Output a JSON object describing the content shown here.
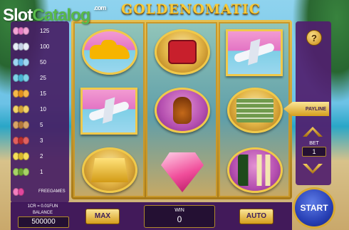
{
  "branding": {
    "site_logo_part1": "Slot",
    "site_logo_part2": "Catalog",
    "site_logo_suffix": ".com",
    "game_title": "GOLDENOMATIC"
  },
  "paytable": {
    "rows": [
      {
        "icon": "pink-triple-icon",
        "value": "125",
        "colors": [
          "#f2a5d6",
          "#e77ac3",
          "#f2a5d6"
        ]
      },
      {
        "icon": "white-triple-icon",
        "value": "100",
        "colors": [
          "#e8eef8",
          "#c5d1e6",
          "#e8eef8"
        ]
      },
      {
        "icon": "blue-triple-icon",
        "value": "50",
        "colors": [
          "#9fd6f2",
          "#5fb3e2",
          "#9fd6f2"
        ]
      },
      {
        "icon": "cyan-triple-icon",
        "value": "25",
        "colors": [
          "#7ed2e8",
          "#48b2d2",
          "#7ed2e8"
        ]
      },
      {
        "icon": "orange-coin-icon",
        "value": "15",
        "colors": [
          "#f7b84a",
          "#e28e1c",
          "#f7b84a"
        ]
      },
      {
        "icon": "gold-coin-icon",
        "value": "10",
        "colors": [
          "#f3d36a",
          "#d3a23a",
          "#f3d36a"
        ]
      },
      {
        "icon": "bronze-coin-icon",
        "value": "5",
        "colors": [
          "#d9a468",
          "#b4773a",
          "#d9a468"
        ]
      },
      {
        "icon": "red-coin-icon",
        "value": "3",
        "colors": [
          "#e16060",
          "#b82f2f",
          "#e16060"
        ]
      },
      {
        "icon": "yellow-coin-icon",
        "value": "2",
        "colors": [
          "#f6de5a",
          "#d8b72a",
          "#f6de5a"
        ]
      },
      {
        "icon": "green-coin-icon",
        "value": "1",
        "colors": [
          "#a7d466",
          "#6fa533",
          "#a7d466"
        ]
      }
    ],
    "freegames_label": "FREEGAMES"
  },
  "reels": {
    "reel_1": [
      "yellow-sports-car",
      "private-jet",
      "gold-bars"
    ],
    "reel_2": [
      "ruby-ring-box",
      "cognac-glass",
      "pink-diamond"
    ],
    "reel_3": [
      "private-jet",
      "cash-stack",
      "champagne-bottle"
    ]
  },
  "controls": {
    "help_label": "?",
    "payline_label": "PAYLINE",
    "bet_label": "BET",
    "bet_value": "1",
    "start_label": "START",
    "max_label": "MAX",
    "auto_label": "AUTO"
  },
  "status": {
    "cr_rate": "1CR = 0.01FUN",
    "balance_label": "BALANCE",
    "balance_value": "500000",
    "win_label": "WIN",
    "win_value": "0"
  }
}
